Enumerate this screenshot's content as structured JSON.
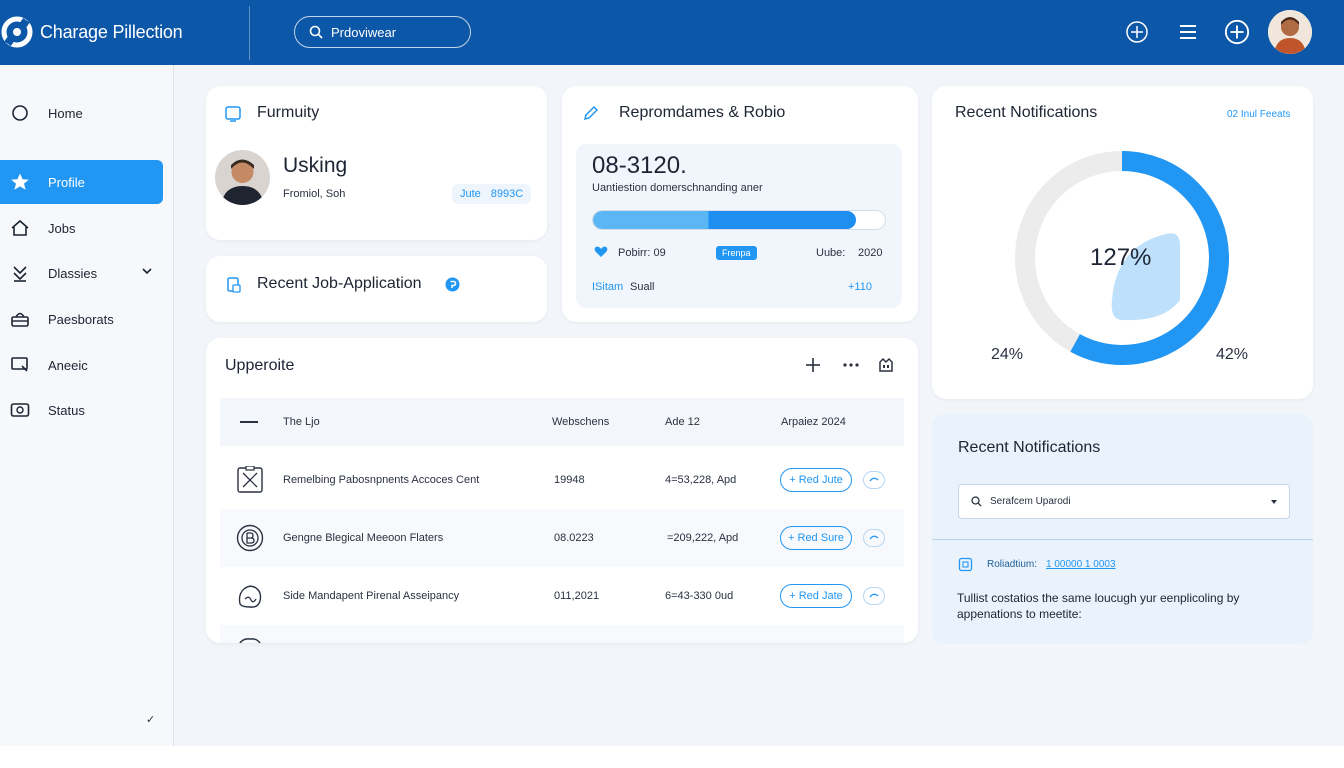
{
  "header": {
    "app_name": "Charage Pillection",
    "search_value": "Prdoviwear",
    "icons": [
      "plus-circle-icon",
      "menu-icon",
      "add-circle-icon",
      "avatar"
    ]
  },
  "sidebar": {
    "items": [
      {
        "label": "Home",
        "icon": "circle-icon",
        "active": false
      },
      {
        "label": "Profile",
        "icon": "star-icon",
        "active": true
      },
      {
        "label": "Jobs",
        "icon": "house-icon",
        "active": false
      },
      {
        "label": "Dlassies",
        "icon": "filter-icon",
        "active": false
      },
      {
        "label": "Paesborats",
        "icon": "basket-icon",
        "active": false
      },
      {
        "label": "Aneeic",
        "icon": "monitor-icon",
        "active": false
      },
      {
        "label": "Status",
        "icon": "ticket-icon",
        "active": false
      }
    ],
    "footer_mark": "✓"
  },
  "profile_card": {
    "title": "Furmuity",
    "name": "Usking",
    "subtitle": "Fromiol, Soh",
    "badge_label": "Jute",
    "badge_value": "8993C"
  },
  "recent_job": {
    "title": "Recent Job-Application"
  },
  "report_card": {
    "title": "Repromdames & Robio",
    "big_value": "08-3120.",
    "caption": "Uantiestion domerschnanding aner",
    "progress": 0.9,
    "stat_label": "Pobirr: 09",
    "stat_badge": "Frenpa",
    "stat_right_label": "Uube:",
    "stat_right_value": "2020",
    "footer_left_a": "ISitam",
    "footer_left_b": "Suall",
    "footer_right": "+110"
  },
  "notifications_card": {
    "title": "Recent Notifications",
    "link": "02 Inul Feeats",
    "center_value": "127%",
    "left_label": "24%",
    "right_label": "42%",
    "donut_fraction": 0.58
  },
  "table_card": {
    "title": "Upperoite",
    "columns": [
      "The Ljo",
      "Webschens",
      "Ade 12",
      "Arpaiez 2024"
    ],
    "rows": [
      {
        "icon": "scan-icon",
        "name": "Remelbing Pabosnpnents Accoces Cent",
        "num": "19948",
        "amount": "4=53,228, Apd",
        "action": "+ Red Jute"
      },
      {
        "icon": "b-circle-icon",
        "name": "Gengne Blegical Meeoon Flaters",
        "num": "08.0223",
        "amount": "=209,222, Apd",
        "action": "+ Red Sure"
      },
      {
        "icon": "hand-icon",
        "name": "Side Mandapent Pirenal Asseipancy",
        "num": "011,2021",
        "amount": "6=43-330 0ud",
        "action": "+ Red Jate"
      }
    ]
  },
  "notifications_panel": {
    "title": "Recent Notifications",
    "search_placeholder": "Serafcem Uparodi",
    "item_label": "Roliadtium:",
    "item_value": "1 00000 1 0003",
    "message": "Tullist costatios the same loucugh yur eenplicoling by appenations to meetite:"
  },
  "colors": {
    "header": "#0d57a8",
    "accent": "#2196f3",
    "donut_light": "#bfe0fb",
    "track": "#ececec"
  }
}
